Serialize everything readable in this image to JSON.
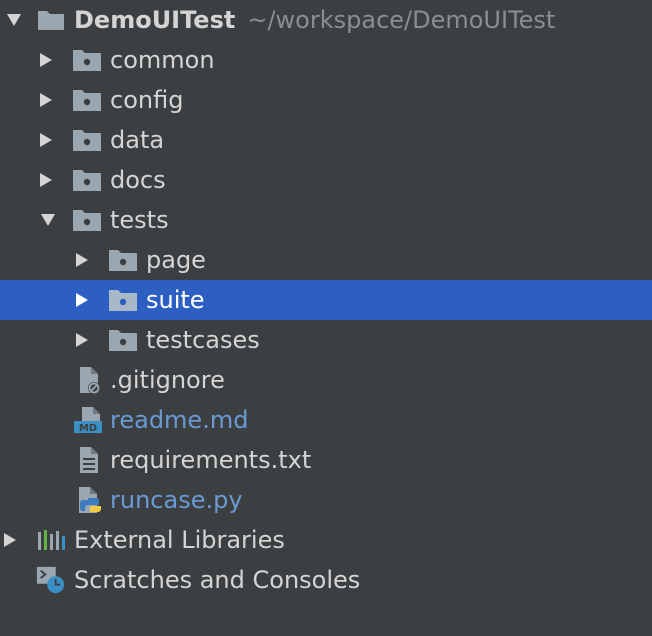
{
  "tree": {
    "root": {
      "name": "DemoUITest",
      "path": "~/workspace/DemoUITest",
      "expanded": true
    },
    "folders": [
      {
        "name": "common",
        "expanded": false
      },
      {
        "name": "config",
        "expanded": false
      },
      {
        "name": "data",
        "expanded": false
      },
      {
        "name": "docs",
        "expanded": false
      },
      {
        "name": "tests",
        "expanded": true
      }
    ],
    "tests_children": [
      {
        "name": "page",
        "expanded": false
      },
      {
        "name": "suite",
        "expanded": false,
        "selected": true
      },
      {
        "name": "testcases",
        "expanded": false
      }
    ],
    "files": [
      {
        "name": ".gitignore",
        "icon": "gitignore-file-icon"
      },
      {
        "name": "readme.md",
        "icon": "markdown-file-icon",
        "color": "#6a9ad4"
      },
      {
        "name": "requirements.txt",
        "icon": "text-file-icon"
      },
      {
        "name": "runcase.py",
        "icon": "python-file-icon",
        "color": "#6a9ad4"
      }
    ],
    "external_libraries": {
      "name": "External Libraries",
      "expanded": false
    },
    "scratches": {
      "name": "Scratches and Consoles"
    }
  },
  "colors": {
    "background": "#3c3f41",
    "selection": "#2d5fc3",
    "folder_icon": "#9aa7b0",
    "vcs_added_text": "#6a9ad4",
    "path_text": "#8b8e90"
  }
}
